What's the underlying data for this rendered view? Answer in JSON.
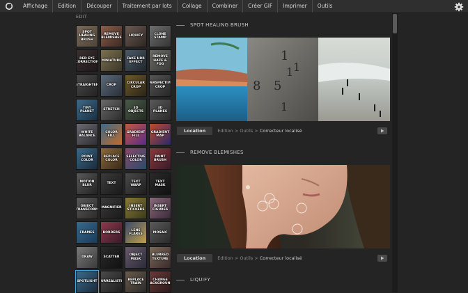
{
  "menubar": {
    "items": [
      "Affichage",
      "Edition",
      "Découper",
      "Traitement par lots",
      "Collage",
      "Combiner",
      "Créer GIF",
      "Imprimer",
      "Outils"
    ]
  },
  "sidebar": {
    "title": "EDIT",
    "tools": [
      {
        "label": "SPOT HEALING BRUSH",
        "bg": "linear-gradient(135deg,#7a6a5a,#4d4438)"
      },
      {
        "label": "REMOVE BLEMISHES",
        "bg": "linear-gradient(135deg,#8a5e4c,#3d2a22)"
      },
      {
        "label": "LIQUIFY",
        "bg": "linear-gradient(135deg,#6b5a52,#2e2623)"
      },
      {
        "label": "CLONE STAMP",
        "bg": "linear-gradient(135deg,#6e6e6e,#353535)"
      },
      {
        "label": "RED EYE CORRECTION",
        "bg": "linear-gradient(135deg,#3a3030,#1e1818)"
      },
      {
        "label": "MINIATURE",
        "bg": "linear-gradient(135deg,#7b7050,#3c3628)"
      },
      {
        "label": "FAKE HDR EFFECT",
        "bg": "linear-gradient(135deg,#4c5a66,#1f262c)"
      },
      {
        "label": "REMOVE HAZE & FOG",
        "bg": "linear-gradient(135deg,#6a6a66,#3a3a36)"
      },
      {
        "label": "STRAIGHTEN",
        "bg": "linear-gradient(135deg,#4a4a4a,#222222)"
      },
      {
        "label": "CROP",
        "bg": "linear-gradient(135deg,#5b6a7a,#2a3038)"
      },
      {
        "label": "CIRCULAR CROP",
        "bg": "linear-gradient(135deg,#6e5a2a,#2a2418)"
      },
      {
        "label": "PERSPECTIVE CROP",
        "bg": "linear-gradient(135deg,#555555,#262626)"
      },
      {
        "label": "TINY PLANET",
        "bg": "linear-gradient(135deg,#3e6a8a,#1a2f40)"
      },
      {
        "label": "STRETCH",
        "bg": "linear-gradient(135deg,#6a6a6a,#2c2c2c)"
      },
      {
        "label": "3D OBJECTS",
        "bg": "linear-gradient(135deg,#4a5a48,#232a22)"
      },
      {
        "label": "3D PLANES",
        "bg": "linear-gradient(135deg,#5a5a5a,#2a2a2a)"
      },
      {
        "label": "WHITE BALANCE",
        "bg": "linear-gradient(135deg,#6a6a70,#2e2e34)"
      },
      {
        "label": "COLOR FILL",
        "bg": "linear-gradient(135deg,#3a6a8a,#c46a2a)"
      },
      {
        "label": "GRADIENT FILL",
        "bg": "linear-gradient(135deg,#c05a3a,#5a2a8a)"
      },
      {
        "label": "GRADIENT MAP",
        "bg": "linear-gradient(135deg,#c04a2a,#2a2a6a)"
      },
      {
        "label": "POINT COLOR",
        "bg": "linear-gradient(135deg,#3a6a8a,#1a2a3a)"
      },
      {
        "label": "REPLACE COLOR",
        "bg": "linear-gradient(135deg,#8a6a3a,#3a2a1a)"
      },
      {
        "label": "SELECTIVE COLOR",
        "bg": "linear-gradient(135deg,#8a4a6a,#2a4a6a)"
      },
      {
        "label": "PAINT BRUSH",
        "bg": "linear-gradient(135deg,#8a3a3a,#3a1a2a)"
      },
      {
        "label": "MOTION BLUR",
        "bg": "linear-gradient(135deg,#5a5a5a,#222222)"
      },
      {
        "label": "TEXT",
        "bg": "linear-gradient(135deg,#3a3a3a,#1a1a1a)"
      },
      {
        "label": "TEXT WARP",
        "bg": "linear-gradient(135deg,#4a4a4a,#1e1e1e)"
      },
      {
        "label": "TEXT MASK",
        "bg": "linear-gradient(135deg,#2a2a2a,#111111)"
      },
      {
        "label": "OBJECT TRANSFORM",
        "bg": "linear-gradient(135deg,#5a5a5a,#2a2a2a)"
      },
      {
        "label": "MAGNIFIER",
        "bg": "linear-gradient(135deg,#3a3a3a,#1a1a1a)"
      },
      {
        "label": "INSERT STICKERS",
        "bg": "linear-gradient(135deg,#8a7a3a,#3a3a1a)"
      },
      {
        "label": "INSERT FIGURES",
        "bg": "linear-gradient(135deg,#8a6a7a,#3a2a3a)"
      },
      {
        "label": "FRAMES",
        "bg": "linear-gradient(135deg,#3a6a8a,#1a3a5a)"
      },
      {
        "label": "BORDERS",
        "bg": "linear-gradient(135deg,#8a3a4a,#3a1a2a)"
      },
      {
        "label": "LENS FLARES",
        "bg": "linear-gradient(135deg,#3a4a6a,#c0a04a)"
      },
      {
        "label": "MOSAIC",
        "bg": "linear-gradient(135deg,#5a5a5a,#2a2a2a)"
      },
      {
        "label": "DRAW",
        "bg": "linear-gradient(135deg,#7a7a7a,#3a3a3a)"
      },
      {
        "label": "SCATTER",
        "bg": "linear-gradient(135deg,#2a2a2a,#111111)"
      },
      {
        "label": "OBJECT MASK",
        "bg": "linear-gradient(135deg,#6a5a6a,#2a2a3a)"
      },
      {
        "label": "BLURRED TEXTURE",
        "bg": "linear-gradient(135deg,#7a6a5a,#3a2a2a)"
      },
      {
        "label": "SPOTLIGHT",
        "bg": "linear-gradient(135deg,#3a6a8a,#1a2a3a)",
        "active": true
      },
      {
        "label": "SURREALISTIC",
        "bg": "linear-gradient(135deg,#4a4a4a,#1e1e1e)"
      },
      {
        "label": "REPLACE TRAIN",
        "bg": "linear-gradient(135deg,#6a5a4a,#2a2a2a)"
      },
      {
        "label": "CHANGE BACKGROUND",
        "bg": "linear-gradient(135deg,#6a3a3a,#2a1a1a)"
      }
    ]
  },
  "sections": [
    {
      "title": "SPOT HEALING BRUSH",
      "location_label": "Location",
      "crumb_path": "Edition > Outils >",
      "crumb_current": "Correcteur localisé"
    },
    {
      "title": "REMOVE BLEMISHES",
      "location_label": "Location",
      "crumb_path": "Edition > Outils >",
      "crumb_current": "Correcteur localisé"
    },
    {
      "title": "LIQUIFY"
    }
  ],
  "colors": {
    "accent": "#3fa8e0",
    "background": "#242424",
    "menubar": "#2f2f2f"
  }
}
